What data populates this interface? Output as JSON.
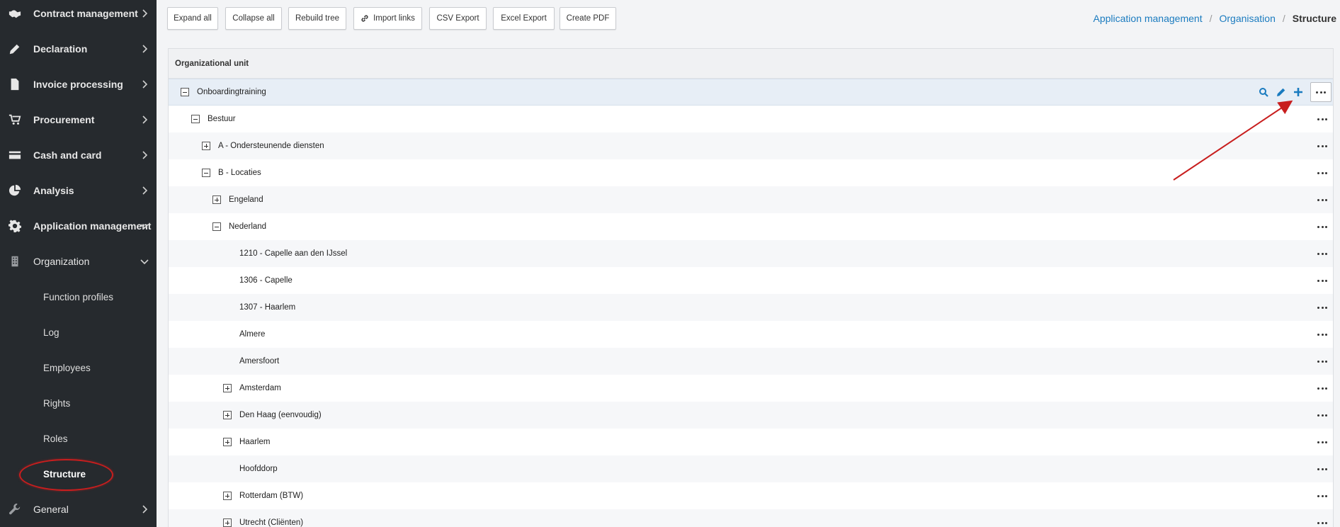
{
  "sidebar": {
    "items": [
      {
        "label": "Contract management",
        "icon": "handshake-icon"
      },
      {
        "label": "Declaration",
        "icon": "pencil-icon"
      },
      {
        "label": "Invoice processing",
        "icon": "document-icon"
      },
      {
        "label": "Procurement",
        "icon": "cart-icon"
      },
      {
        "label": "Cash and card",
        "icon": "credit-card-icon"
      },
      {
        "label": "Analysis",
        "icon": "pie-chart-icon"
      },
      {
        "label": "Application management",
        "icon": "gear-icon"
      },
      {
        "label": "Organization",
        "icon": "building-icon"
      },
      {
        "label": "General",
        "icon": "wrench-icon"
      }
    ],
    "sub_items": [
      {
        "label": "Function profiles"
      },
      {
        "label": "Log"
      },
      {
        "label": "Employees"
      },
      {
        "label": "Rights"
      },
      {
        "label": "Roles"
      },
      {
        "label": "Structure",
        "active": true
      }
    ]
  },
  "toolbar": {
    "expand_all": "Expand all",
    "collapse_all": "Collapse all",
    "rebuild_tree": "Rebuild tree",
    "import_links": "Import links",
    "csv_export": "CSV Export",
    "excel_export": "Excel Export",
    "create_pdf": "Create PDF"
  },
  "breadcrumb": {
    "first": "Application management",
    "second": "Organisation",
    "current": "Structure"
  },
  "panel": {
    "header": "Organizational unit",
    "rows": [
      {
        "label": "Onboardingtraining",
        "toggle": "minus"
      },
      {
        "label": "Bestuur",
        "toggle": "minus"
      },
      {
        "label": "A - Ondersteunende diensten",
        "toggle": "plus"
      },
      {
        "label": "B - Locaties",
        "toggle": "minus"
      },
      {
        "label": "Engeland",
        "toggle": "plus"
      },
      {
        "label": "Nederland",
        "toggle": "minus"
      },
      {
        "label": "1210 - Capelle aan den IJssel",
        "toggle": "none"
      },
      {
        "label": "1306 - Capelle",
        "toggle": "none"
      },
      {
        "label": "1307 - Haarlem",
        "toggle": "none"
      },
      {
        "label": "Almere",
        "toggle": "none"
      },
      {
        "label": "Amersfoort",
        "toggle": "none"
      },
      {
        "label": "Amsterdam",
        "toggle": "plus"
      },
      {
        "label": "Den Haag (eenvoudig)",
        "toggle": "plus"
      },
      {
        "label": "Haarlem",
        "toggle": "plus"
      },
      {
        "label": "Hoofddorp",
        "toggle": "none"
      },
      {
        "label": "Rotterdam (BTW)",
        "toggle": "plus"
      },
      {
        "label": "Utrecht (Cliënten)",
        "toggle": "plus"
      }
    ]
  },
  "colors": {
    "sidebar_bg": "#262a2e",
    "link_blue": "#1a7bbf",
    "annotation_red": "#c81e1e"
  }
}
